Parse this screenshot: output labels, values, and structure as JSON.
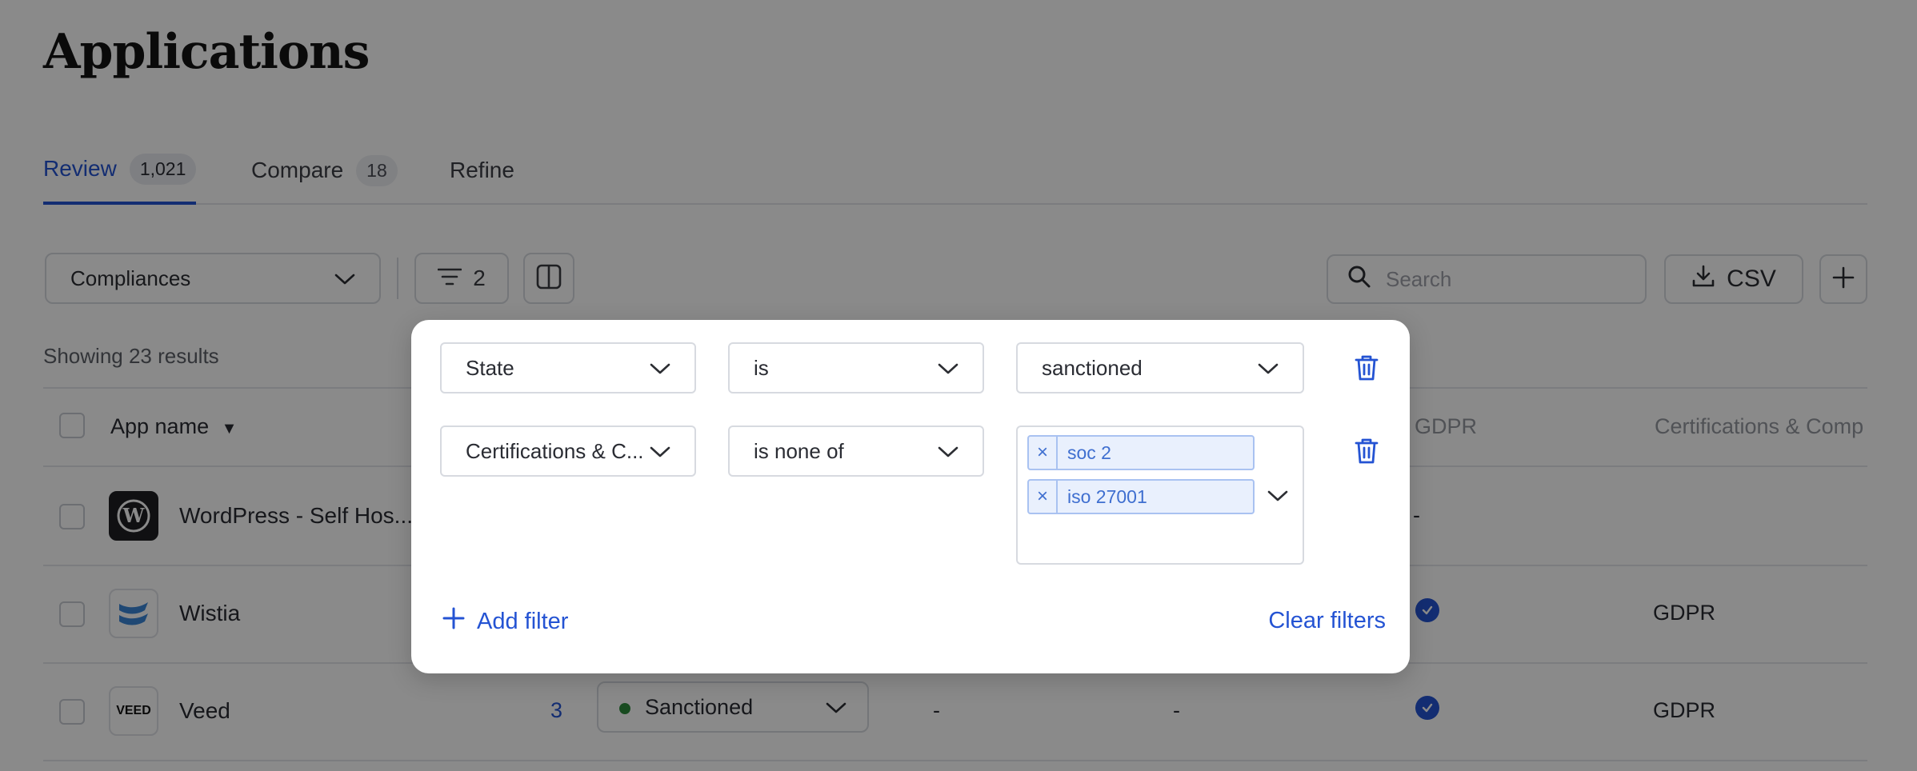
{
  "page": {
    "title": "Applications"
  },
  "tabs": [
    {
      "label": "Review",
      "count": "1,021"
    },
    {
      "label": "Compare",
      "count": "18"
    },
    {
      "label": "Refine"
    }
  ],
  "toolbar": {
    "group_by": "Compliances",
    "filter_count": "2",
    "search_placeholder": "Search",
    "csv_label": "CSV"
  },
  "results_text": "Showing 23 results",
  "table": {
    "headers": {
      "app_name": "App name",
      "gdpr": "GDPR",
      "certifications": "Certifications & Comp"
    },
    "rows": [
      {
        "name": "WordPress - Self Hos...",
        "logo": "wordpress-logo",
        "gdpr": "-",
        "certifications": ""
      },
      {
        "name": "Wistia",
        "logo": "wistia-logo",
        "gdpr": "check",
        "certifications": "GDPR"
      },
      {
        "name": "Veed",
        "logo": "veed-logo",
        "logo_text": "VEED",
        "count": "3",
        "state": "Sanctioned",
        "col_a": "-",
        "col_b": "-",
        "gdpr": "check",
        "certifications": "GDPR"
      }
    ]
  },
  "filters": {
    "rows": [
      {
        "field": "State",
        "operator": "is",
        "value": "sanctioned"
      },
      {
        "field": "Certifications & C...",
        "operator": "is none of",
        "values": [
          "soc 2",
          "iso 27001"
        ]
      }
    ],
    "add_label": "Add filter",
    "clear_label": "Clear filters"
  },
  "colors": {
    "accent": "#2453d3",
    "state_dot": "#2e8b3c"
  }
}
